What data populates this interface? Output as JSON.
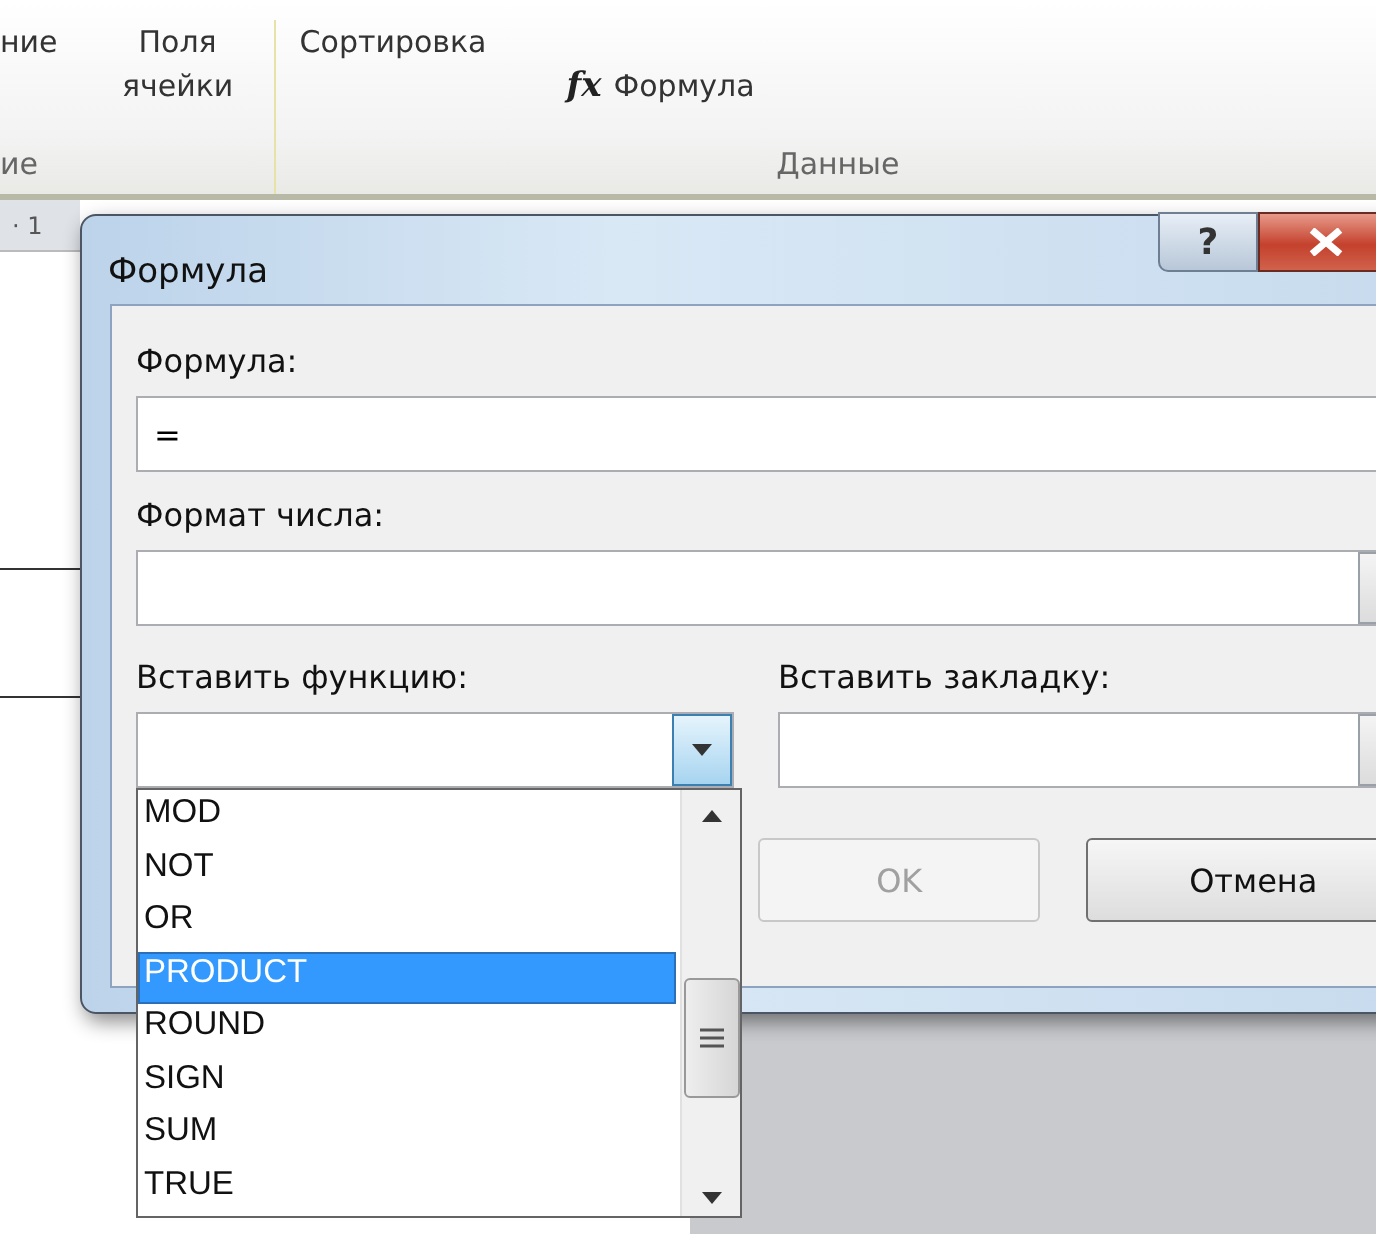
{
  "ribbon": {
    "groups": [
      {
        "buttons": [
          {
            "label": "ние"
          },
          {
            "label": "Поля ячейки"
          }
        ],
        "label": "ие"
      },
      {
        "buttons": [
          {
            "label": "Сортировка"
          },
          {
            "label": "Формула",
            "icon": "fx"
          }
        ],
        "label": "Данные"
      }
    ]
  },
  "ruler": {
    "mark": "· 1"
  },
  "dialog": {
    "title": "Формула",
    "help": "?",
    "formula": {
      "label": "Формула:",
      "value": "="
    },
    "number_format": {
      "label": "Формат числа:"
    },
    "paste_function": {
      "label": "Вставить функцию:",
      "open": true,
      "items": [
        {
          "label": "MOD",
          "selected": false
        },
        {
          "label": "NOT",
          "selected": false
        },
        {
          "label": "OR",
          "selected": false
        },
        {
          "label": "PRODUCT",
          "selected": true
        },
        {
          "label": "ROUND",
          "selected": false
        },
        {
          "label": "SIGN",
          "selected": false
        },
        {
          "label": "SUM",
          "selected": false
        },
        {
          "label": "TRUE",
          "selected": false
        }
      ]
    },
    "paste_bookmark": {
      "label": "Вставить закладку:"
    },
    "buttons": [
      {
        "label": "OK",
        "disabled": true
      },
      {
        "label": "Отмена",
        "disabled": false
      }
    ]
  }
}
